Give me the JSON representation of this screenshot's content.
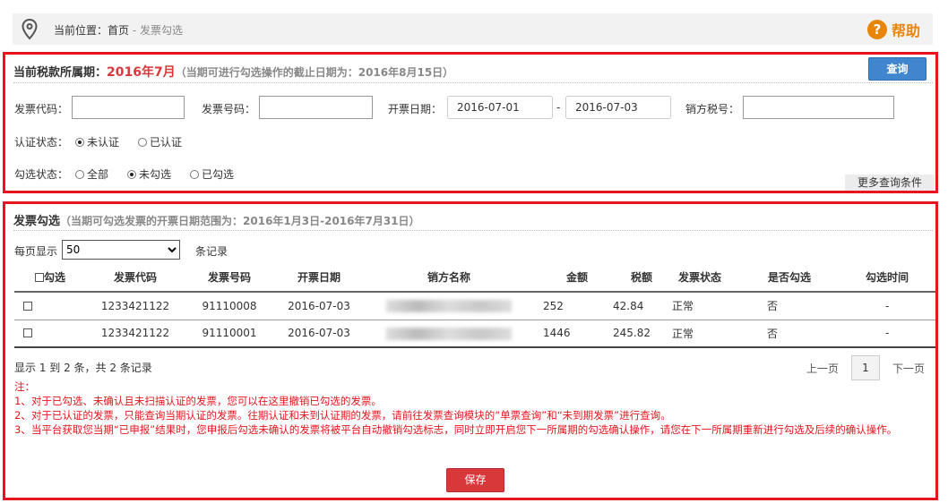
{
  "breadcrumb": {
    "label": "当前位置：",
    "home": "首页",
    "sep": " - ",
    "current": "发票勾选"
  },
  "help": {
    "icon": "?",
    "label": "帮助"
  },
  "query_panel": {
    "title": "当前税款所属期：",
    "period": "2016年7月",
    "deadline": "（当期可进行勾选操作的截止日期为：2016年8月15日）",
    "query_button": "查询",
    "invoice_code_label": "发票代码：",
    "invoice_code": "",
    "invoice_number_label": "发票号码：",
    "invoice_number": "",
    "date_label": "开票日期：",
    "date_from": "2016-07-01",
    "date_sep": "-",
    "date_to": "2016-07-03",
    "seller_tax_label": "销方税号：",
    "seller_tax": "",
    "cert_label": "认证状态：",
    "cert_options": [
      "未认证",
      "已认证"
    ],
    "select_label": "勾选状态：",
    "select_options": [
      "全部",
      "未勾选",
      "已勾选"
    ],
    "more_button": "更多查询条件"
  },
  "list_panel": {
    "title": "发票勾选",
    "range": "（当期可勾选发票的开票日期范围为：2016年1月3日-2016年7月31日）",
    "page_size_label": "每页显示",
    "page_size": "50",
    "page_size_suffix": "条记录",
    "columns": [
      "勾选",
      "发票代码",
      "发票号码",
      "开票日期",
      "销方名称",
      "金额",
      "税额",
      "发票状态",
      "是否勾选",
      "勾选时间"
    ],
    "rows": [
      {
        "code": "1233421122",
        "number": "91110008",
        "date": "2016-07-03",
        "amount": "252",
        "tax": "42.84",
        "status": "正常",
        "selected": "否",
        "time": "-"
      },
      {
        "code": "1233421122",
        "number": "91110001",
        "date": "2016-07-03",
        "amount": "1446",
        "tax": "245.82",
        "status": "正常",
        "selected": "否",
        "time": "-"
      }
    ],
    "summary": "显示 1 到 2 条，共 2 条记录",
    "prev": "上一页",
    "page": "1",
    "next": "下一页",
    "notes_title": "注：",
    "notes": [
      "1、对于已勾选、未确认且未扫描认证的发票，您可以在这里撤销已勾选的发票。",
      "2、对于已认证的发票，只能查询当期认证的发票。往期认证和未到认证期的发票，请前往发票查询模块的“单票查询”和“未到期发票”进行查询。",
      "3、当平台获取您当期“已申报”结果时，您申报后勾选未确认的发票将被平台自动撤销勾选标志，同时立即开启您下一所属期的勾选确认操作，请您在下一所属期重新进行勾选及后续的确认操作。"
    ],
    "save_button": "保存"
  }
}
